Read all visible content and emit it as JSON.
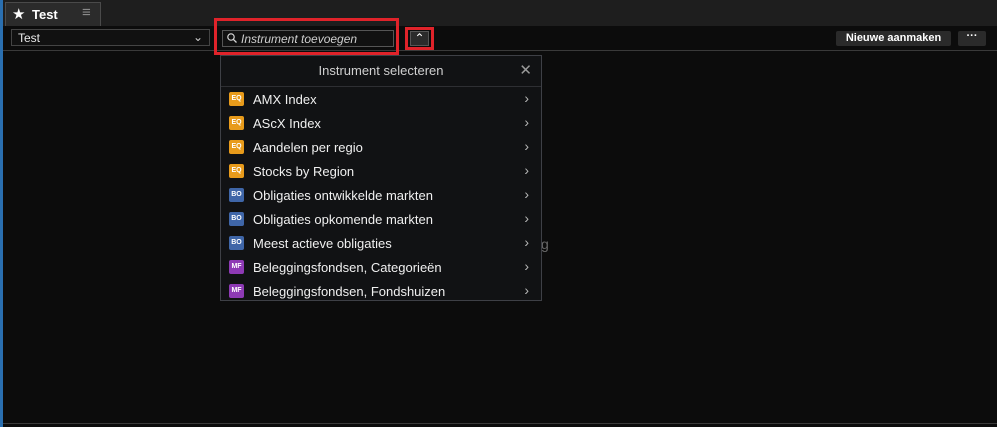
{
  "tab": {
    "title": "Test",
    "icon": "star-icon",
    "menu_icon": "hamburger-icon"
  },
  "toolbar": {
    "select_value": "Test",
    "search_placeholder": "Instrument toevoegen",
    "new_button": "Nieuwe aanmaken",
    "more_button": "···"
  },
  "background_text": "g",
  "dropdown": {
    "title": "Instrument selecteren",
    "items": [
      {
        "badge": "EQ",
        "kind": "eq",
        "label": "AMX Index"
      },
      {
        "badge": "EQ",
        "kind": "eq",
        "label": "AScX Index"
      },
      {
        "badge": "EQ",
        "kind": "eq",
        "label": "Aandelen per regio"
      },
      {
        "badge": "EQ",
        "kind": "eq",
        "label": "Stocks by Region"
      },
      {
        "badge": "BO",
        "kind": "bo",
        "label": "Obligaties ontwikkelde markten"
      },
      {
        "badge": "BO",
        "kind": "bo",
        "label": "Obligaties opkomende markten"
      },
      {
        "badge": "BO",
        "kind": "bo",
        "label": "Meest actieve obligaties"
      },
      {
        "badge": "MF",
        "kind": "mf",
        "label": "Beleggingsfondsen, Categorieën"
      },
      {
        "badge": "MF",
        "kind": "mf",
        "label": "Beleggingsfondsen, Fondshuizen"
      }
    ]
  },
  "colors": {
    "accent_border": "#2a6fb0",
    "highlight": "#e0232a",
    "equity": "#e89b1b",
    "bond": "#3f66a8",
    "fund": "#8e3ab5"
  }
}
